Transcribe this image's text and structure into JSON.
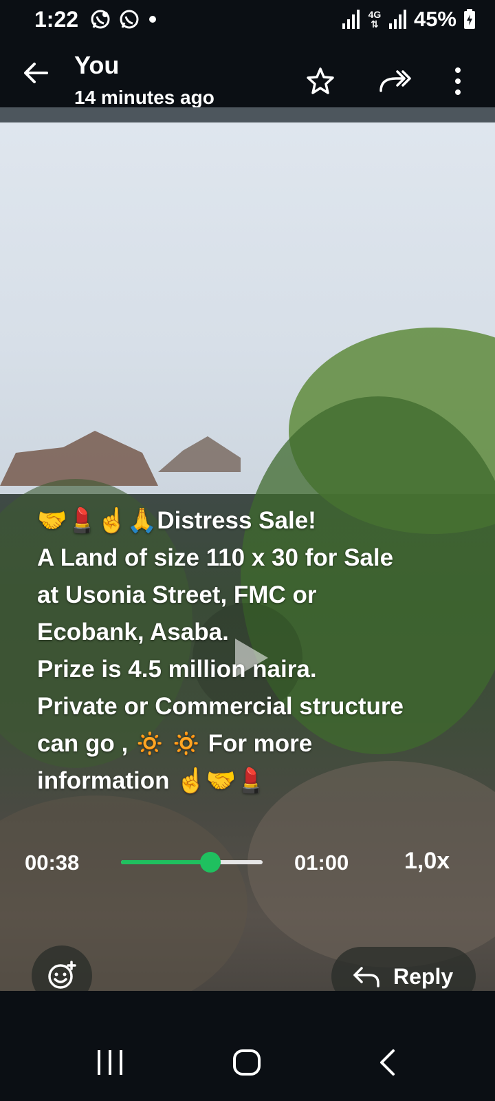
{
  "status_bar": {
    "time": "1:22",
    "network": "4G",
    "battery": "45%",
    "icons": [
      "whatsapp-business-icon",
      "whatsapp-icon",
      "dot-icon",
      "signal-icon",
      "network-4g-icon",
      "signal-icon",
      "battery-charging-icon"
    ]
  },
  "header": {
    "title": "You",
    "subtitle": "14 minutes ago",
    "icons": [
      "back-arrow-icon",
      "star-icon",
      "forward-icon",
      "more-vert-icon"
    ]
  },
  "status_post": {
    "caption_lines": [
      "🤝💄☝️🙏Distress Sale!",
      "A Land of size 110 x 30 for Sale",
      "at Usonia Street, FMC or",
      "Ecobank, Asaba.",
      "Prize is 4.5 million naira.",
      "Private or Commercial structure",
      "can go , 🔅 🔅  For more",
      "information ☝️🤝💄"
    ]
  },
  "player": {
    "current_time": "00:38",
    "total_time": "01:00",
    "speed": "1,0x",
    "progress": 0.633,
    "accent": "#1fc05f"
  },
  "actions": {
    "reply_label": "Reply",
    "icons": [
      "emoji-add-icon",
      "reply-icon"
    ]
  },
  "nav_bar": {
    "icons": [
      "recents-icon",
      "home-icon",
      "back-icon"
    ]
  }
}
